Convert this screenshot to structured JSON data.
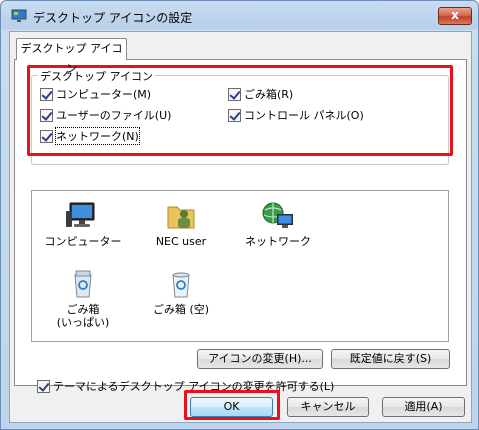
{
  "window": {
    "title": "デスクトップ アイコンの設定",
    "close_glyph": "x"
  },
  "tab": {
    "label": "デスクトップ アイコン"
  },
  "group": {
    "legend": "デスクトップ アイコン",
    "checkboxes": [
      {
        "label": "コンピューター(M)",
        "checked": true
      },
      {
        "label": "ごみ箱(R)",
        "checked": true
      },
      {
        "label": "ユーザーのファイル(U)",
        "checked": true
      },
      {
        "label": "コントロール パネル(O)",
        "checked": true
      },
      {
        "label": "ネットワーク(N)",
        "checked": true
      }
    ]
  },
  "icons": [
    {
      "label": "コンピューター",
      "icon": "computer-icon"
    },
    {
      "label": "NEC user",
      "icon": "user-folder-icon"
    },
    {
      "label": "ネットワーク",
      "icon": "network-icon"
    },
    {
      "label_line1": "ごみ箱",
      "label_line2": "(いっぱい)",
      "icon": "recycle-bin-full-icon"
    },
    {
      "label": "ごみ箱 (空)",
      "icon": "recycle-bin-empty-icon"
    }
  ],
  "buttons": {
    "change_icon": "アイコンの変更(H)...",
    "restore_default": "既定値に戻す(S)",
    "ok": "OK",
    "cancel": "キャンセル",
    "apply": "適用(A)"
  },
  "allow_themes": {
    "label": "テーマによるデスクトップ アイコンの変更を許可する(L)",
    "checked": true
  },
  "colors": {
    "highlight": "#e8101c",
    "title_bar": "#c9dcf0"
  }
}
